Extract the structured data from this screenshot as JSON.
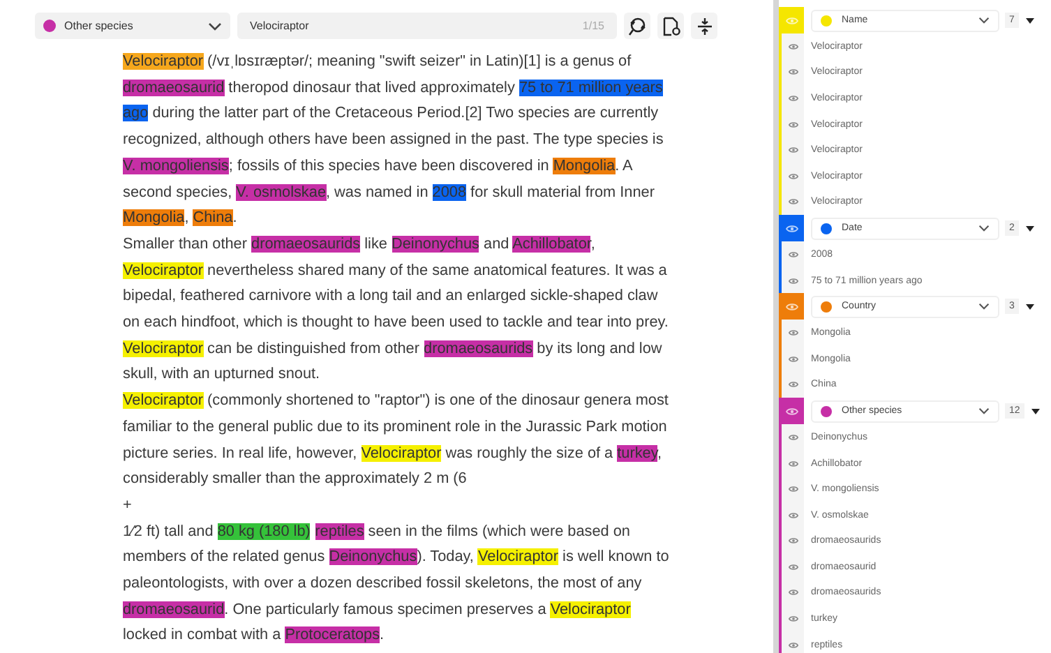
{
  "toolbar": {
    "category": {
      "label": "Other species",
      "color": "#c62fa6"
    },
    "search": {
      "value": "Velociraptor",
      "count": "1/15"
    }
  },
  "paragraphs": [
    [
      {
        "text": "Velociraptor",
        "color": "#f6a71c"
      },
      {
        "text": " (/vɪˌlɒsɪræptər/; meaning \"swift seizer\" in Latin)[1] is a genus of "
      },
      {
        "text": "dromaeosaurid",
        "color": "#c62fa6"
      },
      {
        "text": " theropod dinosaur that lived approximately "
      },
      {
        "text": "75 to 71 million years ago",
        "color": "#0a64f0"
      },
      {
        "text": " during the latter part of the Cretaceous Period.[2] Two species are currently recognized, although others have been assigned in the past. The type species is "
      },
      {
        "text": "V. mongoliensis",
        "color": "#c62fa6"
      },
      {
        "text": "; fossils of this species have been discovered in "
      },
      {
        "text": "Mongolia",
        "color": "#ee7d0a"
      },
      {
        "text": ". A second species, "
      },
      {
        "text": "V. osmolskae",
        "color": "#c62fa6"
      },
      {
        "text": ", was named in "
      },
      {
        "text": "2008",
        "color": "#0a64f0"
      },
      {
        "text": " for skull material from Inner "
      },
      {
        "text": "Mongolia",
        "color": "#ee7d0a"
      },
      {
        "text": ", "
      },
      {
        "text": "China",
        "color": "#ee7d0a"
      },
      {
        "text": "."
      }
    ],
    [
      {
        "text": "Smaller than other "
      },
      {
        "text": "dromaeosaurids",
        "color": "#c62fa6"
      },
      {
        "text": " like "
      },
      {
        "text": "Deinonychus",
        "color": "#c62fa6"
      },
      {
        "text": " and "
      },
      {
        "text": "Achillobator",
        "color": "#c62fa6"
      },
      {
        "text": ", "
      },
      {
        "text": "Velociraptor",
        "color": "#f5f000"
      },
      {
        "text": " nevertheless shared many of the same anatomical features. It was a bipedal, feathered carnivore with a long tail and an enlarged sickle-shaped claw on each hindfoot, which is thought to have been used to tackle and tear into prey. "
      },
      {
        "text": "Velociraptor",
        "color": "#f5f000"
      },
      {
        "text": " can be distinguished from other "
      },
      {
        "text": "dromaeosaurids",
        "color": "#c62fa6"
      },
      {
        "text": " by its long and low skull, with an upturned snout."
      }
    ],
    [
      {
        "text": "Velociraptor",
        "color": "#f5f000"
      },
      {
        "text": " (commonly shortened to \"raptor\") is one of the dinosaur genera most familiar to the general public due to its prominent role in the Jurassic Park motion picture series. In real life, however, "
      },
      {
        "text": "Velociraptor",
        "color": "#f5f000"
      },
      {
        "text": " was roughly the size of a "
      },
      {
        "text": "turkey",
        "color": "#c62fa6"
      },
      {
        "text": ", considerably smaller than the approximately 2 m (6"
      }
    ],
    [
      {
        "text": "+"
      }
    ],
    [
      {
        "text": "1⁄2 ft) tall and "
      },
      {
        "text": "80 kg (180 lb)",
        "color": "#35c23a",
        "spaced": true
      },
      {
        "text": "reptiles",
        "color": "#c62fa6"
      },
      {
        "text": " seen in the films (which were based on members of the related genus "
      },
      {
        "text": "Deinonychus",
        "color": "#c62fa6"
      },
      {
        "text": "). Today, "
      },
      {
        "text": "Velociraptor",
        "color": "#f5f000"
      },
      {
        "text": " is well known to paleontologists, with over a dozen described fossil skeletons, the most of any "
      },
      {
        "text": "dromaeosaurid",
        "color": "#c62fa6"
      },
      {
        "text": ". One particularly famous specimen preserves a "
      },
      {
        "text": "Velociraptor",
        "color": "#f5f000"
      },
      {
        "text": " locked in combat with a "
      },
      {
        "text": "Protoceratops",
        "color": "#c62fa6"
      },
      {
        "text": "."
      }
    ]
  ],
  "groups": [
    {
      "name": "Name",
      "color": "#f5e600",
      "count": "7",
      "items": [
        "Velociraptor",
        "Velociraptor",
        "Velociraptor",
        "Velociraptor",
        "Velociraptor",
        "Velociraptor",
        "Velociraptor"
      ]
    },
    {
      "name": "Date",
      "color": "#0a64f0",
      "count": "2",
      "items": [
        "2008",
        "75 to 71 million years ago"
      ]
    },
    {
      "name": "Country",
      "color": "#ee7d0a",
      "count": "3",
      "items": [
        "Mongolia",
        "Mongolia",
        "China"
      ]
    },
    {
      "name": "Other species",
      "color": "#c62fa6",
      "count": "12",
      "items": [
        "Deinonychus",
        "Achillobator",
        "V. mongoliensis",
        "V. osmolskae",
        "dromaeosaurids",
        "dromaeosaurid",
        "dromaeosaurids",
        "turkey",
        "reptiles"
      ]
    }
  ]
}
